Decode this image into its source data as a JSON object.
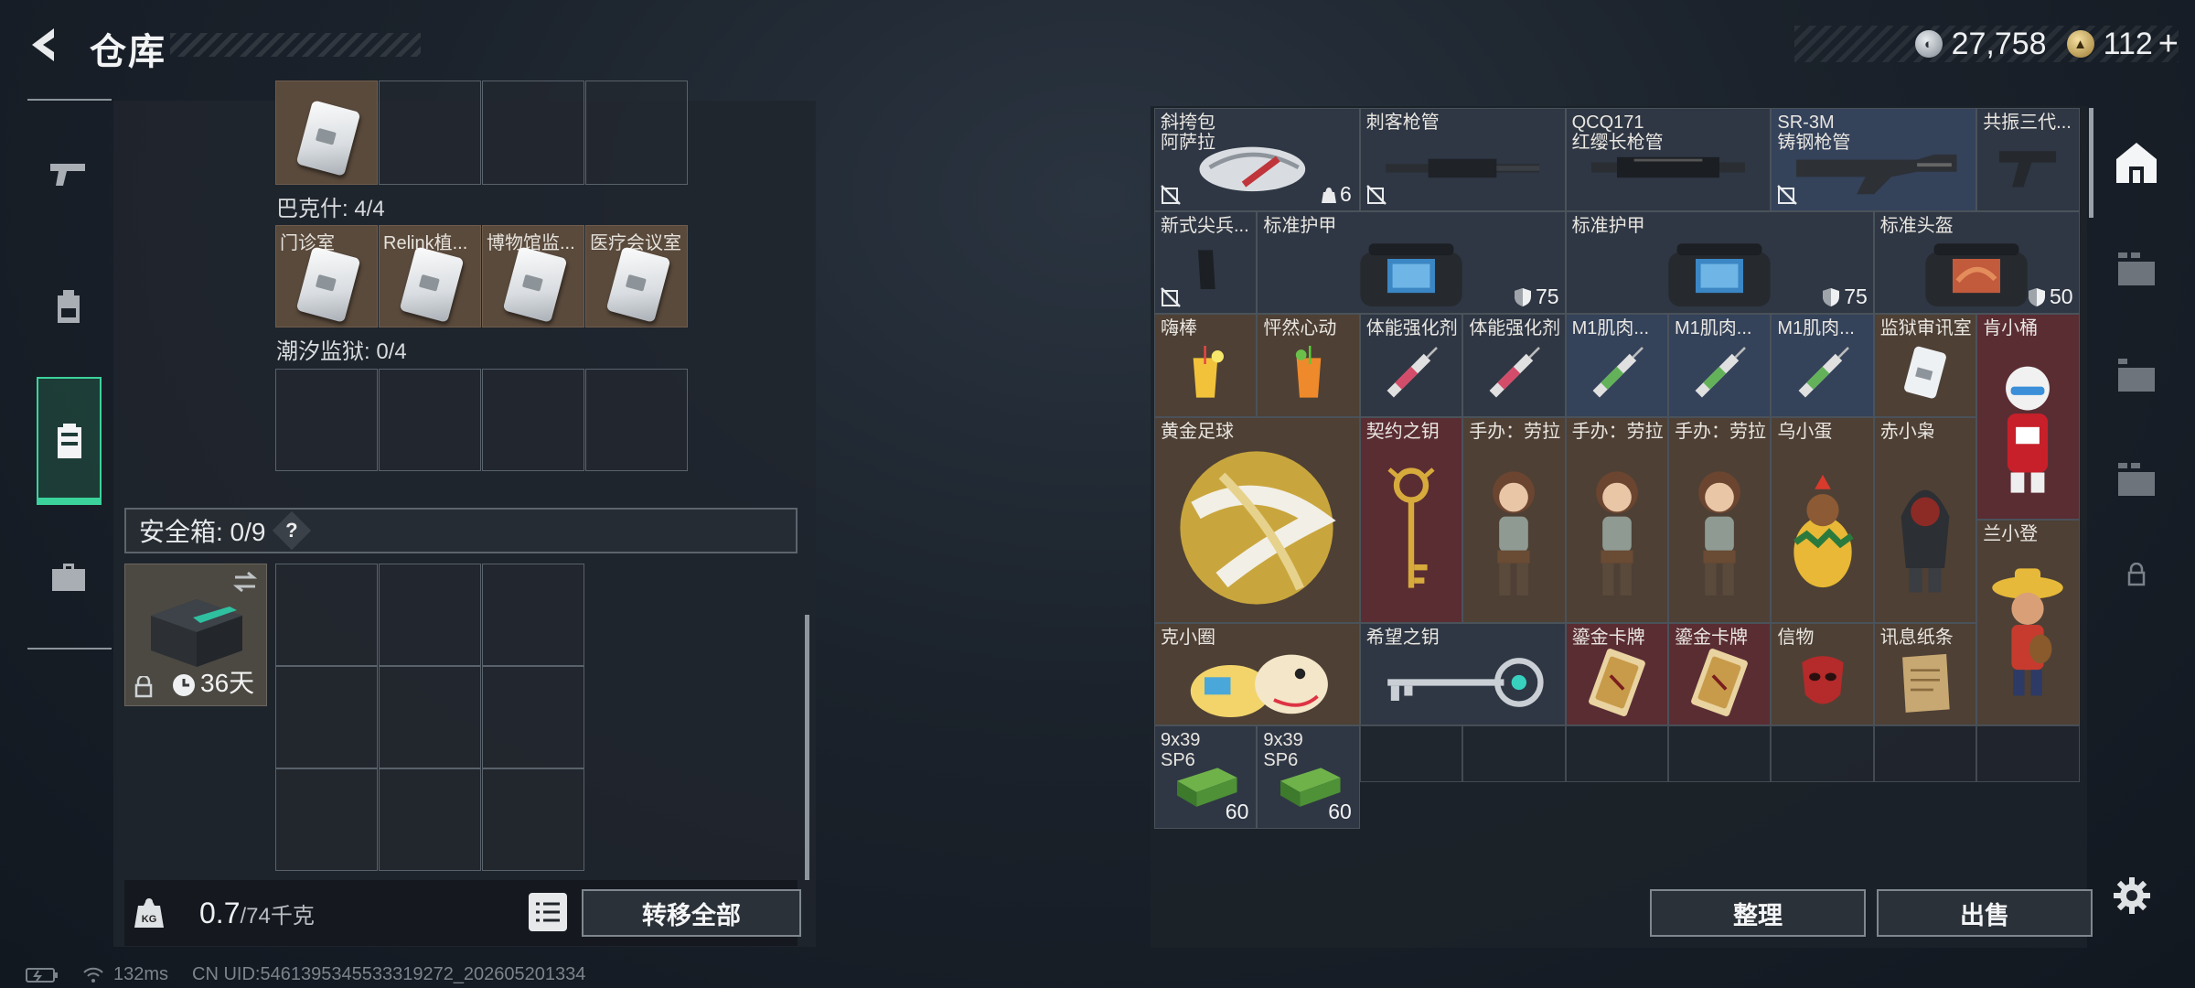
{
  "header": {
    "title": "仓库",
    "currencies": [
      {
        "icon": "silver-coin-icon",
        "value": "27,758"
      },
      {
        "icon": "gold-coin-icon",
        "value": "112"
      }
    ],
    "add_label": "+"
  },
  "left_nav": {
    "items": [
      "pistol-icon",
      "backpack-icon",
      "container-icon",
      "briefcase-icon"
    ],
    "active": "container-icon"
  },
  "left_panel": {
    "groups": [
      {
        "label": "巴克什: 4/4",
        "cells": [
          "门诊室",
          "Relink植...",
          "博物馆监...",
          "医疗会议室"
        ]
      },
      {
        "label": "潮汐监狱: 0/4",
        "cells": []
      }
    ],
    "safebox": {
      "label": "安全箱: 0/9",
      "help": "?",
      "duration": "36天"
    },
    "weight": {
      "current": "0.7",
      "max": "/74千克"
    },
    "transfer_label": "转移全部"
  },
  "right_panel": {
    "items": [
      {
        "name": "斜挎包\n阿萨拉",
        "count": "6"
      },
      {
        "name": "刺客枪管"
      },
      {
        "name": "QCQ171\n红缨长枪管"
      },
      {
        "name": "SR-3M\n铸钢枪管"
      },
      {
        "name": "共振三代..."
      },
      {
        "name": "新式尖兵..."
      },
      {
        "name": "标准护甲",
        "armor": "75"
      },
      {
        "name": "标准护甲",
        "armor": "75"
      },
      {
        "name": "标准头盔",
        "armor": "50"
      },
      {
        "name": "嗨棒"
      },
      {
        "name": "怦然心动"
      },
      {
        "name": "体能强化剂"
      },
      {
        "name": "体能强化剂"
      },
      {
        "name": "M1肌肉..."
      },
      {
        "name": "M1肌肉..."
      },
      {
        "name": "M1肌肉..."
      },
      {
        "name": "监狱审讯室"
      },
      {
        "name": "肯小桶"
      },
      {
        "name": "黄金足球"
      },
      {
        "name": "契约之钥"
      },
      {
        "name": "手办：劳拉"
      },
      {
        "name": "手办：劳拉"
      },
      {
        "name": "手办：劳拉"
      },
      {
        "name": "乌小蛋"
      },
      {
        "name": "赤小枭"
      },
      {
        "name": "兰小登"
      },
      {
        "name": "克小圈"
      },
      {
        "name": "希望之钥"
      },
      {
        "name": "鎏金卡牌"
      },
      {
        "name": "鎏金卡牌"
      },
      {
        "name": "信物"
      },
      {
        "name": "讯息纸条"
      },
      {
        "name": "9x39\nSP6",
        "count": "60"
      },
      {
        "name": "9x39\nSP6",
        "count": "60"
      }
    ],
    "sort_label": "整理",
    "sell_label": "出售"
  },
  "status_bar": {
    "ping": "132ms",
    "uid": "CN UID:5461395345533319272_202605201334"
  },
  "colors": {
    "accent": "#3bd39b",
    "rarity_purple": "#2f3744",
    "rarity_blue": "#34425a",
    "rarity_gold": "#4e4035",
    "rarity_red": "#5a2d33"
  }
}
